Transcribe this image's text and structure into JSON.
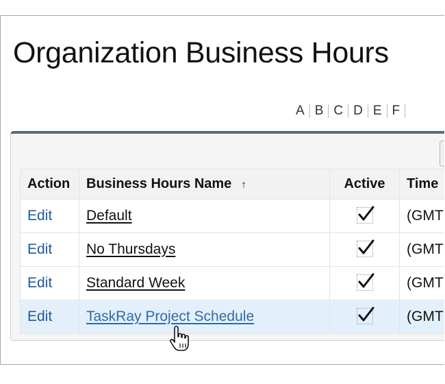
{
  "page": {
    "title": "Organization Business Hours"
  },
  "alphabet": [
    "A",
    "B",
    "C",
    "D",
    "E",
    "F"
  ],
  "table": {
    "columns": {
      "action": "Action",
      "name": "Business Hours Name",
      "name_sort_indicator": "↑",
      "active": "Active",
      "time": "Time"
    },
    "rows": [
      {
        "action": "Edit",
        "name": "Default",
        "active": true,
        "time": "(GMT"
      },
      {
        "action": "Edit",
        "name": "No Thursdays",
        "active": true,
        "time": "(GMT"
      },
      {
        "action": "Edit",
        "name": "Standard Week",
        "active": true,
        "time": "(GMT"
      },
      {
        "action": "Edit",
        "name": "TaskRay Project Schedule",
        "active": true,
        "time": "(GMT",
        "hovered": true
      }
    ]
  },
  "icons": {
    "checkmark": "checkmark-icon",
    "cursor": "hand-pointer-cursor-icon"
  },
  "colors": {
    "link": "#1f5a96",
    "hover_row": "#e3f0fb",
    "panel_top_border": "#5d6b7e"
  }
}
